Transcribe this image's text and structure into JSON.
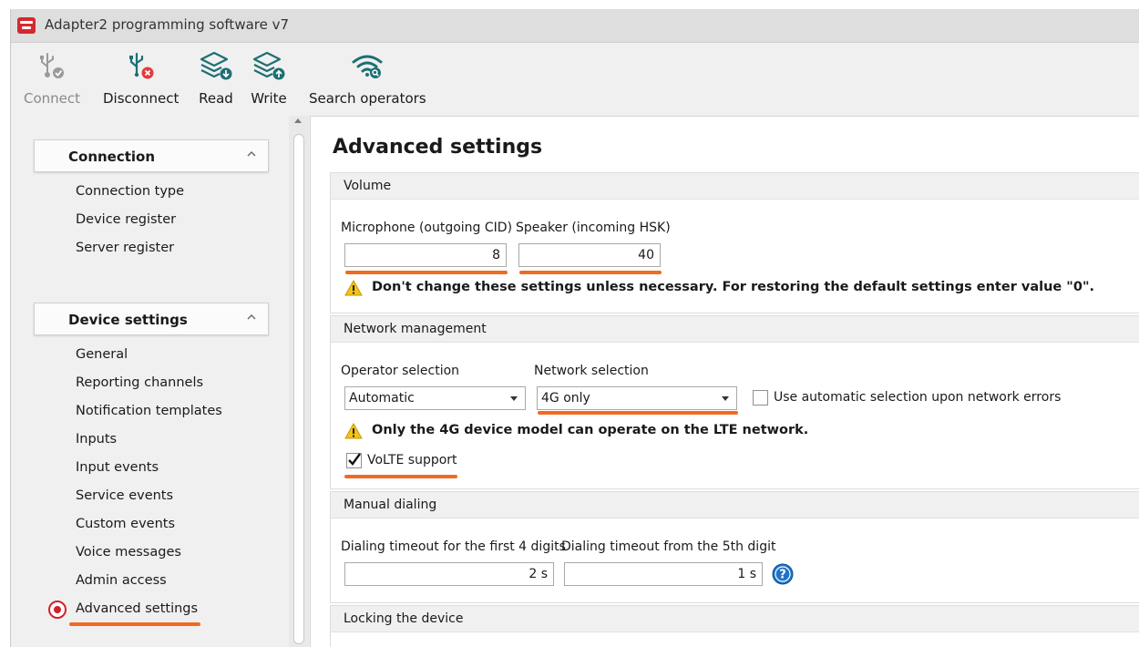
{
  "window": {
    "title": "Adapter2 programming software v7"
  },
  "toolbar": {
    "connect": "Connect",
    "disconnect": "Disconnect",
    "read": "Read",
    "write": "Write",
    "search_operators": "Search operators"
  },
  "sidebar": {
    "connection": {
      "header": "Connection",
      "items": [
        "Connection type",
        "Device register",
        "Server register"
      ]
    },
    "device_settings": {
      "header": "Device settings",
      "items": [
        "General",
        "Reporting channels",
        "Notification templates",
        "Inputs",
        "Input events",
        "Service events",
        "Custom events",
        "Voice messages",
        "Admin access",
        "Advanced settings"
      ],
      "selected": "Advanced settings"
    }
  },
  "main": {
    "title": "Advanced settings",
    "volume": {
      "header": "Volume",
      "microphone_label": "Microphone (outgoing CID)",
      "microphone_value": "8",
      "speaker_label": "Speaker (incoming HSK)",
      "speaker_value": "40",
      "warning": "Don't change these settings unless necessary. For restoring the default settings enter value \"0\"."
    },
    "network": {
      "header": "Network management",
      "operator_label": "Operator selection",
      "operator_value": "Automatic",
      "network_label": "Network selection",
      "network_value": "4G only",
      "auto_select_label": "Use automatic selection upon network errors",
      "auto_select_checked": false,
      "warning": "Only the 4G device model can operate on the LTE network.",
      "volte_label": "VoLTE support",
      "volte_checked": true
    },
    "manual_dialing": {
      "header": "Manual dialing",
      "first_label": "Dialing timeout for the first 4 digits",
      "first_value": "2 s",
      "fifth_label": "Dialing timeout from the 5th digit",
      "fifth_value": "1 s"
    },
    "locking": {
      "header": "Locking the device"
    }
  },
  "colors": {
    "accent_underline": "#f26a21",
    "selected_radio": "#d0212b",
    "icon_teal": "#1d6f73",
    "help_blue": "#1f73c7"
  }
}
